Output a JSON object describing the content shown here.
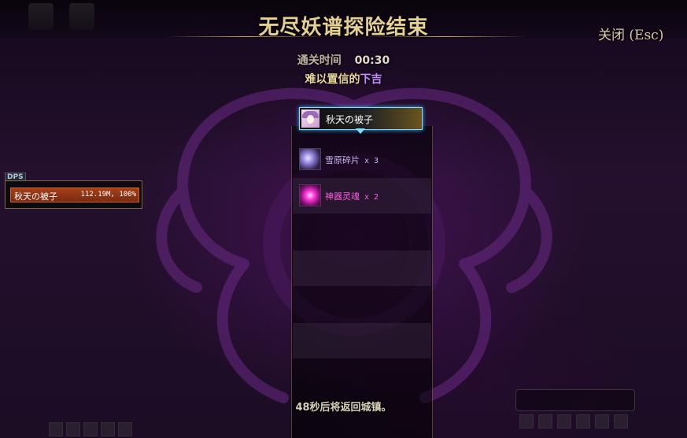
{
  "header": {
    "title": "无尽妖谱探险结束",
    "close_label": "关闭 (Esc)"
  },
  "summary": {
    "clear_time_label": "通关时间",
    "clear_time_value": "00:30",
    "result_prefix": "难以置信的",
    "result_grade": "下吉",
    "grade_color": "#c78cff"
  },
  "rewards": {
    "player_name": "秋天の被子",
    "items": [
      {
        "name": "雪原碎片",
        "qty": "x 3",
        "color": "#c9b8f0",
        "icon": "shard-icon"
      },
      {
        "name": "神器灵魂",
        "qty": "x 2",
        "color": "#ff5ce6",
        "icon": "soul-icon"
      }
    ]
  },
  "dps": {
    "label": "DPS",
    "player_name": "秋天の被子",
    "value": "112.19M, 100%"
  },
  "footer": {
    "return_message": "48秒后将返回城镇。"
  }
}
